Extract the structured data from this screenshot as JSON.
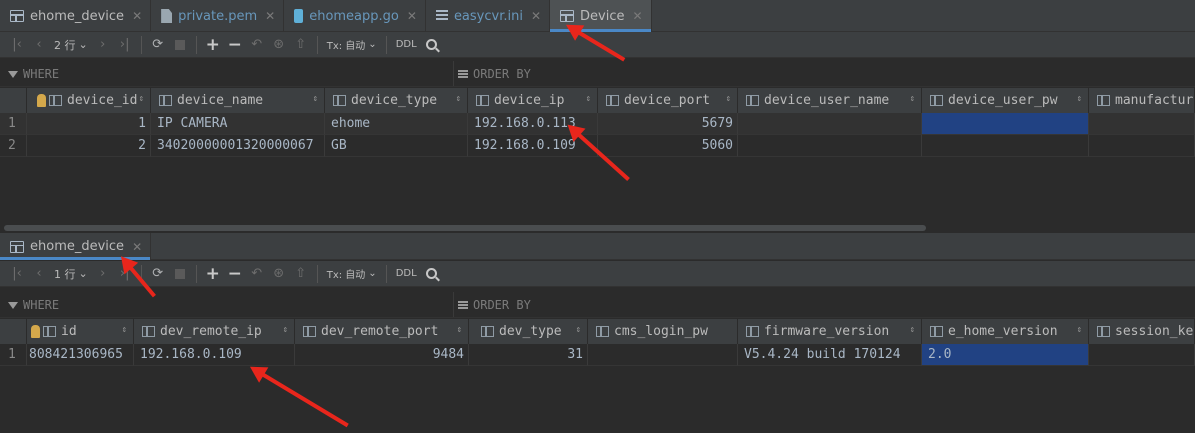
{
  "tabs": [
    {
      "label": "ehome_device",
      "icon": "table-icon",
      "kind": "table"
    },
    {
      "label": "private.pem",
      "icon": "file-icon",
      "kind": "pem"
    },
    {
      "label": "ehomeapp.go",
      "icon": "go-file-icon",
      "kind": "go"
    },
    {
      "label": "easycvr.ini",
      "icon": "ini-file-icon",
      "kind": "ini"
    },
    {
      "label": "Device",
      "icon": "table-icon",
      "kind": "table",
      "active": true
    }
  ],
  "top_panel": {
    "toolbar": {
      "rows_label": "2 行",
      "tx_label": "Tx: 自动",
      "ddl_label": "DDL"
    },
    "where_label": "WHERE",
    "order_label": "ORDER BY",
    "columns": [
      "device_id",
      "device_name",
      "device_type",
      "device_ip",
      "device_port",
      "device_user_name",
      "device_user_pw",
      "manufacturer"
    ],
    "rows": [
      {
        "n": "1",
        "device_id": "1",
        "device_name": "IP CAMERA",
        "device_type": "ehome",
        "device_ip": "192.168.0.113",
        "device_port": "5679",
        "device_user_name": "",
        "device_user_pw": ""
      },
      {
        "n": "2",
        "device_id": "2",
        "device_name": "34020000001320000067",
        "device_type": "GB",
        "device_ip": "192.168.0.109",
        "device_port": "5060",
        "device_user_name": "",
        "device_user_pw": ""
      }
    ]
  },
  "bottom_panel": {
    "tab_label": "ehome_device",
    "toolbar": {
      "rows_label": "1 行",
      "tx_label": "Tx: 自动",
      "ddl_label": "DDL"
    },
    "where_label": "WHERE",
    "order_label": "ORDER BY",
    "columns": [
      "id",
      "dev_remote_ip",
      "dev_remote_port",
      "dev_type",
      "cms_login_pw",
      "firmware_version",
      "e_home_version",
      "session_key"
    ],
    "rows": [
      {
        "n": "1",
        "id": "808421306965",
        "dev_remote_ip": "192.168.0.109",
        "dev_remote_port": "9484",
        "dev_type": "31",
        "cms_login_pw": "",
        "firmware_version": "V5.4.24 build 170124",
        "e_home_version": "2.0"
      }
    ]
  },
  "colors": {
    "accent": "#4a88c7",
    "selection": "#214283",
    "annotation_arrow": "#e8261c"
  }
}
